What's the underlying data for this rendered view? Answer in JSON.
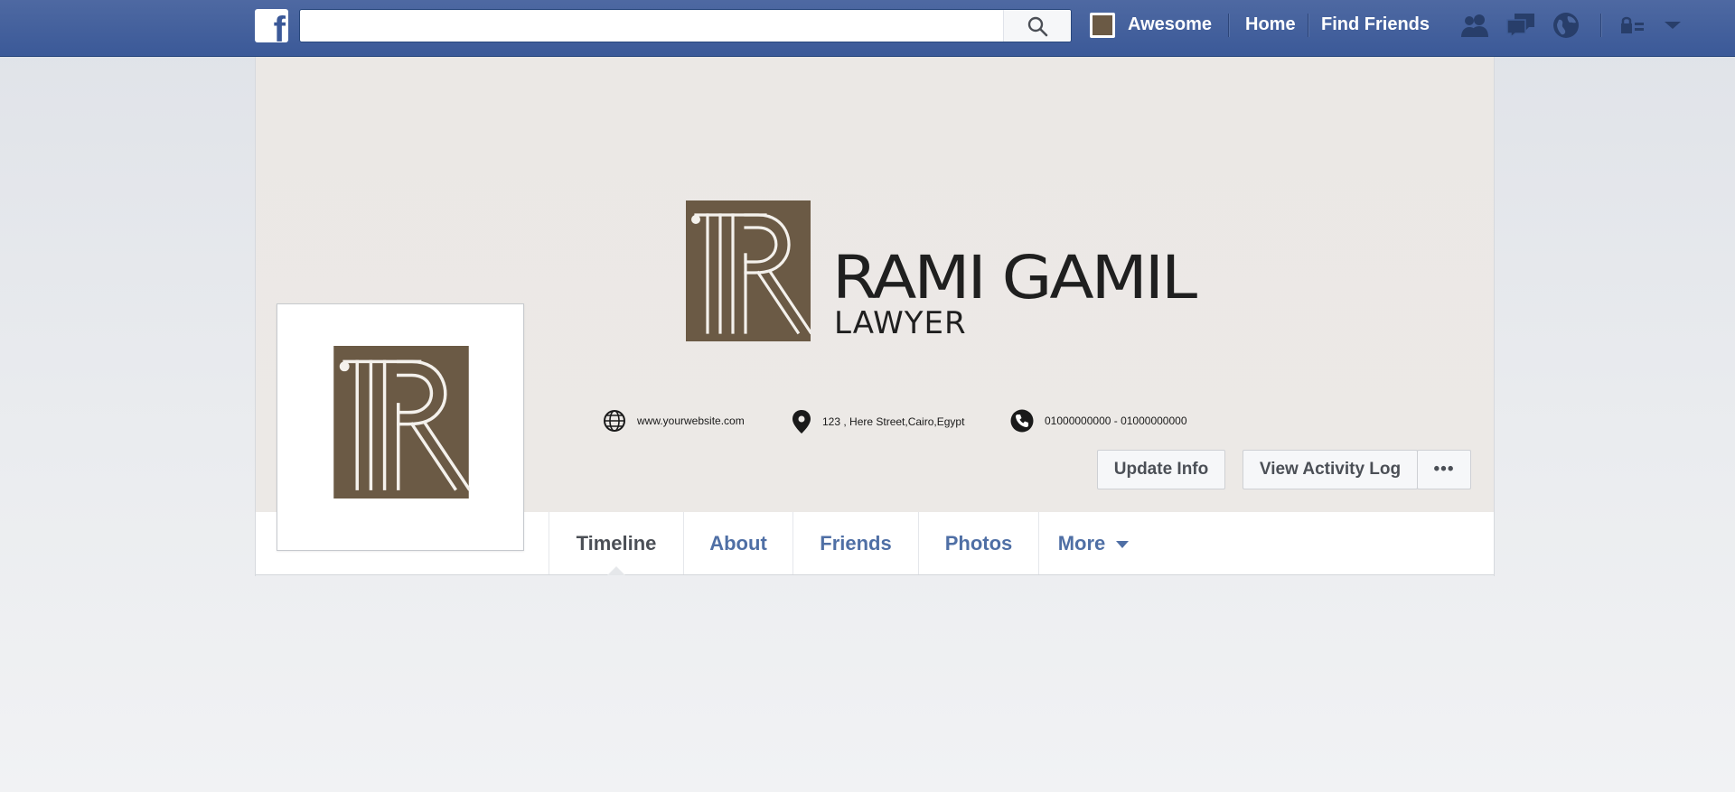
{
  "topbar": {
    "logo_letter": "f",
    "search_placeholder": "",
    "user_name": "Awesome",
    "nav": [
      "Home",
      "Find Friends"
    ],
    "icons": [
      "friend-requests-icon",
      "messages-icon",
      "notifications-globe-icon",
      "privacy-lock-icon",
      "account-menu-arrow-icon"
    ]
  },
  "cover": {
    "brand_name": "RAMI GAMIL",
    "brand_subtitle": "LAWYER",
    "brand_mark_color": "#6b5a45",
    "website": "www.yourwebsite.com",
    "address": "123 , Here Street,Cairo,Egypt",
    "phone": "01000000000 - 01000000000"
  },
  "actions": {
    "update_info": "Update Info",
    "view_activity_log": "View Activity Log",
    "more_dots": "•••"
  },
  "tabs": [
    "Timeline",
    "About",
    "Friends",
    "Photos",
    "More"
  ],
  "colors": {
    "facebook_blue": "#3b5998",
    "tab_link": "#4f6fa5",
    "brand_brown": "#6b5a45"
  }
}
